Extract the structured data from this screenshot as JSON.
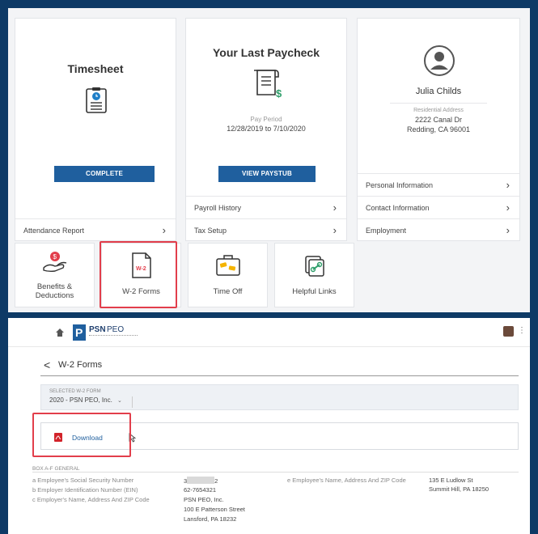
{
  "dashboard": {
    "timesheet": {
      "title": "Timesheet",
      "button": "COMPLETE",
      "link": "Attendance Report"
    },
    "paycheck": {
      "title": "Your Last Paycheck",
      "pay_period_label": "Pay Period",
      "pay_period": "12/28/2019 to 7/10/2020",
      "button": "VIEW PAYSTUB",
      "links": [
        "Payroll History",
        "Tax Setup"
      ]
    },
    "profile": {
      "name": "Julia Childs",
      "address_label": "Residential Address",
      "address_line1": "2222 Canal Dr",
      "address_line2": "Redding, CA 96001",
      "links": [
        "Personal Information",
        "Contact Information",
        "Employment"
      ]
    },
    "tiles": [
      {
        "label_line1": "Benefits &",
        "label_line2": "Deductions",
        "icon": "benefits-icon"
      },
      {
        "label": "W-2 Forms",
        "icon": "w2-form-icon",
        "badge": "W-2"
      },
      {
        "label": "Time Off",
        "icon": "suitcase-icon"
      },
      {
        "label": "Helpful Links",
        "icon": "link-icon"
      }
    ]
  },
  "w2_page": {
    "logo_bold": "PSN",
    "logo_light": "PEO",
    "back_glyph": "<",
    "title": "W-2 Forms",
    "select_label": "SELECTED W-2 FORM",
    "select_value": "2020 - PSN PEO, Inc.",
    "download_label": "Download",
    "section_label": "BOX A-F GENERAL",
    "fields_left": [
      {
        "label": "a Employee's Social Security Number",
        "value_start": "3",
        "value_end": "2"
      },
      {
        "label": "b Employer Identification Number (EIN)",
        "value": "62-7654321"
      },
      {
        "label": "c Employer's Name, Address And ZIP Code",
        "value_lines": [
          "PSN PEO, Inc.",
          "100 E Patterson Street",
          "Lansford, PA 18232"
        ]
      }
    ],
    "field_right": {
      "label": "e Employee's Name, Address And ZIP Code",
      "value_lines": [
        "135 E Ludlow St",
        "Summit Hill, PA 18250"
      ]
    }
  },
  "colors": {
    "background": "#0e3a66",
    "button": "#1f5f9e",
    "highlight": "#e23e4b",
    "accent_green": "#2e9e6a"
  }
}
